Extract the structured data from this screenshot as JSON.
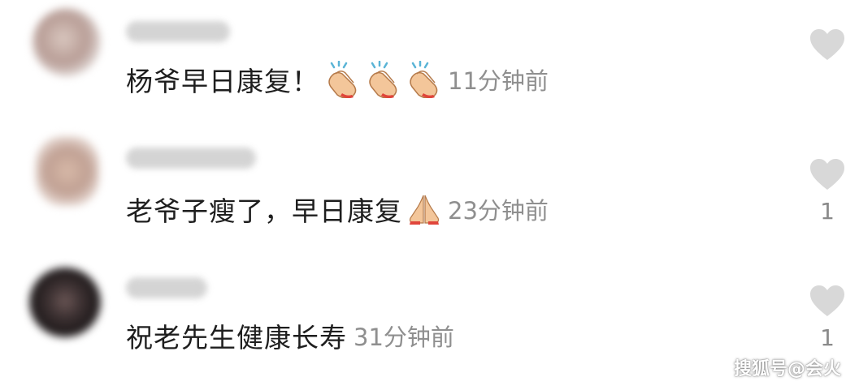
{
  "comments": [
    {
      "text": "杨爷早日康复！",
      "emojis": [
        "clapping-hands-icon",
        "clapping-hands-icon",
        "clapping-hands-icon"
      ],
      "time": "11分钟前",
      "likes": ""
    },
    {
      "text": "老爷子瘦了，早日康复",
      "emojis": [
        "folded-hands-icon"
      ],
      "time": "23分钟前",
      "likes": "1"
    },
    {
      "text": "祝老先生健康长寿",
      "emojis": [],
      "time": "31分钟前",
      "likes": "1"
    }
  ],
  "watermark": "搜狐号@会火",
  "colors": {
    "comment_text": "#1e1e1e",
    "time_text": "#8f8f8f",
    "like_icon": "#d8d8d8",
    "like_count": "#8a8a8a",
    "background": "#ffffff"
  }
}
